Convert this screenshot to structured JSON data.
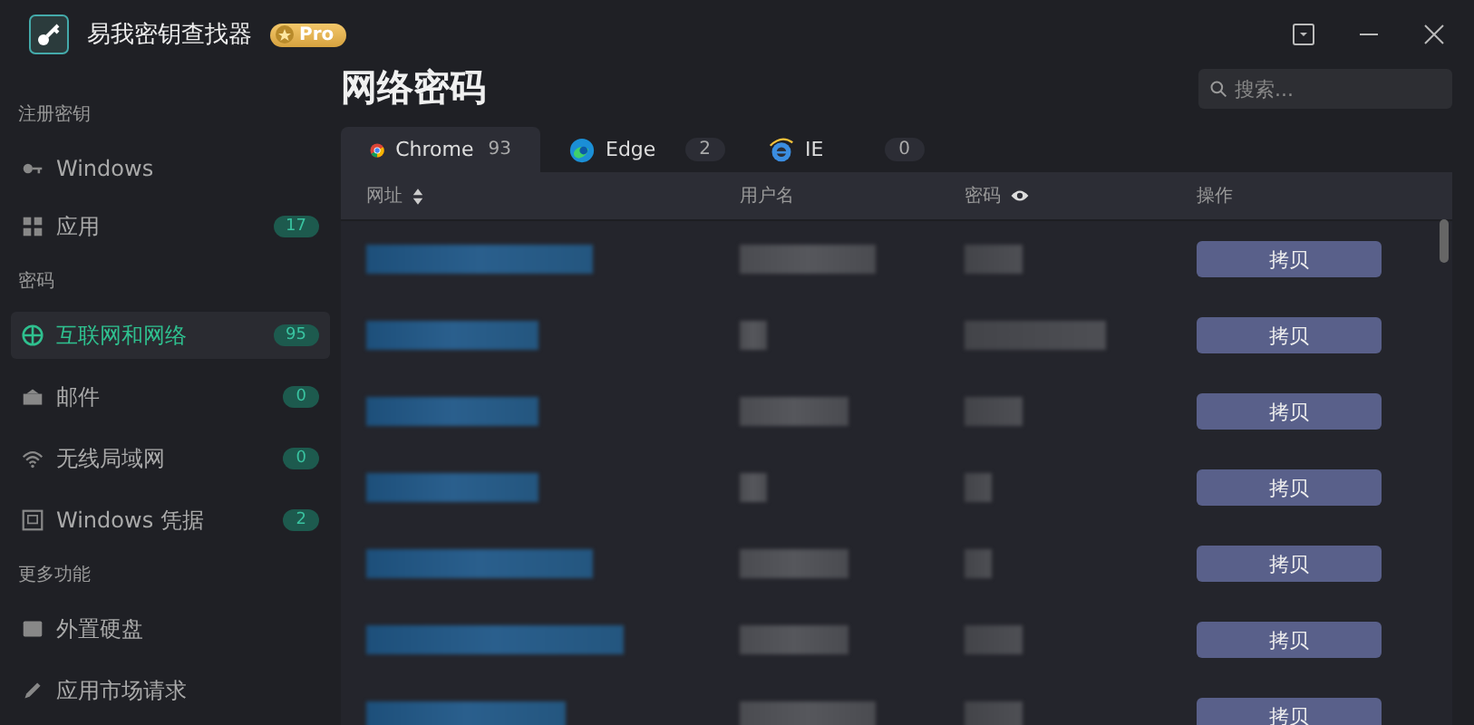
{
  "window": {
    "title": "易我密钥查找器",
    "badge": "Pro"
  },
  "sidebar": {
    "sections": [
      {
        "heading": "注册密钥",
        "items": [
          {
            "kind": "key",
            "label": "Windows",
            "selected": false
          }
        ]
      },
      {
        "items": [
          {
            "kind": "grid",
            "label": "应用",
            "count": "17",
            "selected": false
          }
        ]
      },
      {
        "heading": "密码",
        "items": [
          {
            "kind": "globe",
            "label": "互联网和网络",
            "count": "95",
            "selected": true
          },
          {
            "kind": "mail",
            "label": "邮件",
            "count": "0",
            "selected": false
          },
          {
            "kind": "wifi",
            "label": "无线局域网",
            "count": "0",
            "selected": false
          },
          {
            "kind": "monitor",
            "label": "Windows 凭据",
            "count": "2",
            "selected": false
          }
        ]
      },
      {
        "heading": "更多功能",
        "items": [
          {
            "kind": "drive",
            "label": "外置硬盘",
            "selected": false
          },
          {
            "kind": "edit",
            "label": "应用市场请求",
            "selected": false
          }
        ]
      }
    ]
  },
  "main": {
    "title": "网络密码",
    "search": {
      "placeholder": "搜索..."
    },
    "tabs": [
      {
        "kind": "chrome",
        "label": "Chrome",
        "count": "93",
        "selected": true
      },
      {
        "kind": "edge",
        "label": "Edge",
        "count": "2",
        "selected": false
      },
      {
        "kind": "ie",
        "label": "IE",
        "count": "0",
        "selected": false
      }
    ],
    "columns": [
      "网址",
      "用户名",
      "密码",
      "操作"
    ],
    "rows": [
      {
        "action": "拷贝"
      },
      {
        "action": "拷贝"
      },
      {
        "action": "拷贝"
      },
      {
        "action": "拷贝"
      },
      {
        "action": "拷贝"
      },
      {
        "action": "拷贝"
      },
      {
        "action": "拷贝"
      }
    ]
  }
}
